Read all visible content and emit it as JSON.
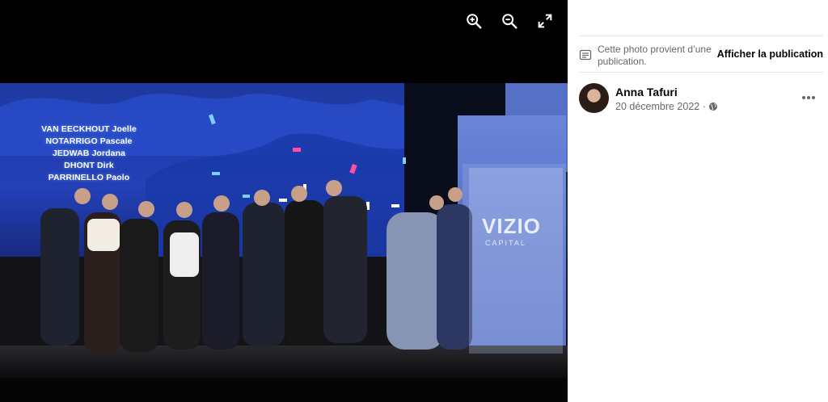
{
  "viewer": {
    "toolbar": [
      {
        "name": "zoom-in",
        "icon": "zoom-in-icon"
      },
      {
        "name": "zoom-out",
        "icon": "zoom-out-icon"
      },
      {
        "name": "fullscreen",
        "icon": "fullscreen-expand-icon"
      }
    ],
    "screen_names": [
      "VAN EECKHOUT Joelle",
      "NOTARRIGO Pascale",
      "JEDWAB Jordana",
      "DHONT Dirk",
      "PARRINELLO Paolo"
    ],
    "banner_brand": "VIZIO",
    "banner_sub": "CAPITAL"
  },
  "sidebar": {
    "notice_icon": "post-icon",
    "notice_text": "Cette photo provient d’une publication.",
    "notice_link": "Afficher la publication",
    "author_name": "Anna Tafuri",
    "post_date": "20 décembre 2022 ·",
    "privacy_icon": "globe-icon",
    "more_icon": "more-options-icon"
  },
  "colors": {
    "viewer_bg": "#000000",
    "link_text": "#050505",
    "secondary_text": "#65676b",
    "divider": "#e4e6eb"
  }
}
